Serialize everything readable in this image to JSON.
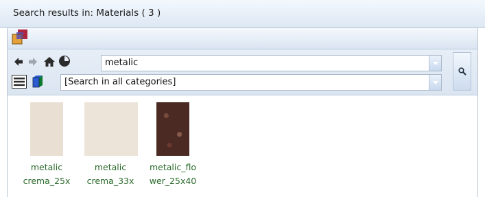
{
  "window": {
    "title": "Search results in: Materials ( 3 )"
  },
  "navigation": {
    "back_icon": "back-arrow-icon",
    "forward_icon": "forward-arrow-icon",
    "home_icon": "home-icon",
    "recent_icon": "clock-icon"
  },
  "search": {
    "query": "metalic",
    "category": "[Search in all categories]",
    "search_icon": "magnifier-icon"
  },
  "view": {
    "list_view_icon": "list-view-icon",
    "category_icon": "category-cube-icon"
  },
  "results": [
    {
      "label_line1": "metalic",
      "label_line2": "crema_25x",
      "thumb_color": "#e9dfd3"
    },
    {
      "label_line1": "metalic",
      "label_line2": "crema_33x",
      "thumb_color": "#ece4d9"
    },
    {
      "label_line1": "metalic_flo",
      "label_line2": "wer_25x40",
      "thumb_color": "#4a2a22"
    }
  ],
  "colors": {
    "label_text": "#2a6a2a",
    "toolbar_bg": "#dbe5f1",
    "border": "#b7c4d3"
  }
}
